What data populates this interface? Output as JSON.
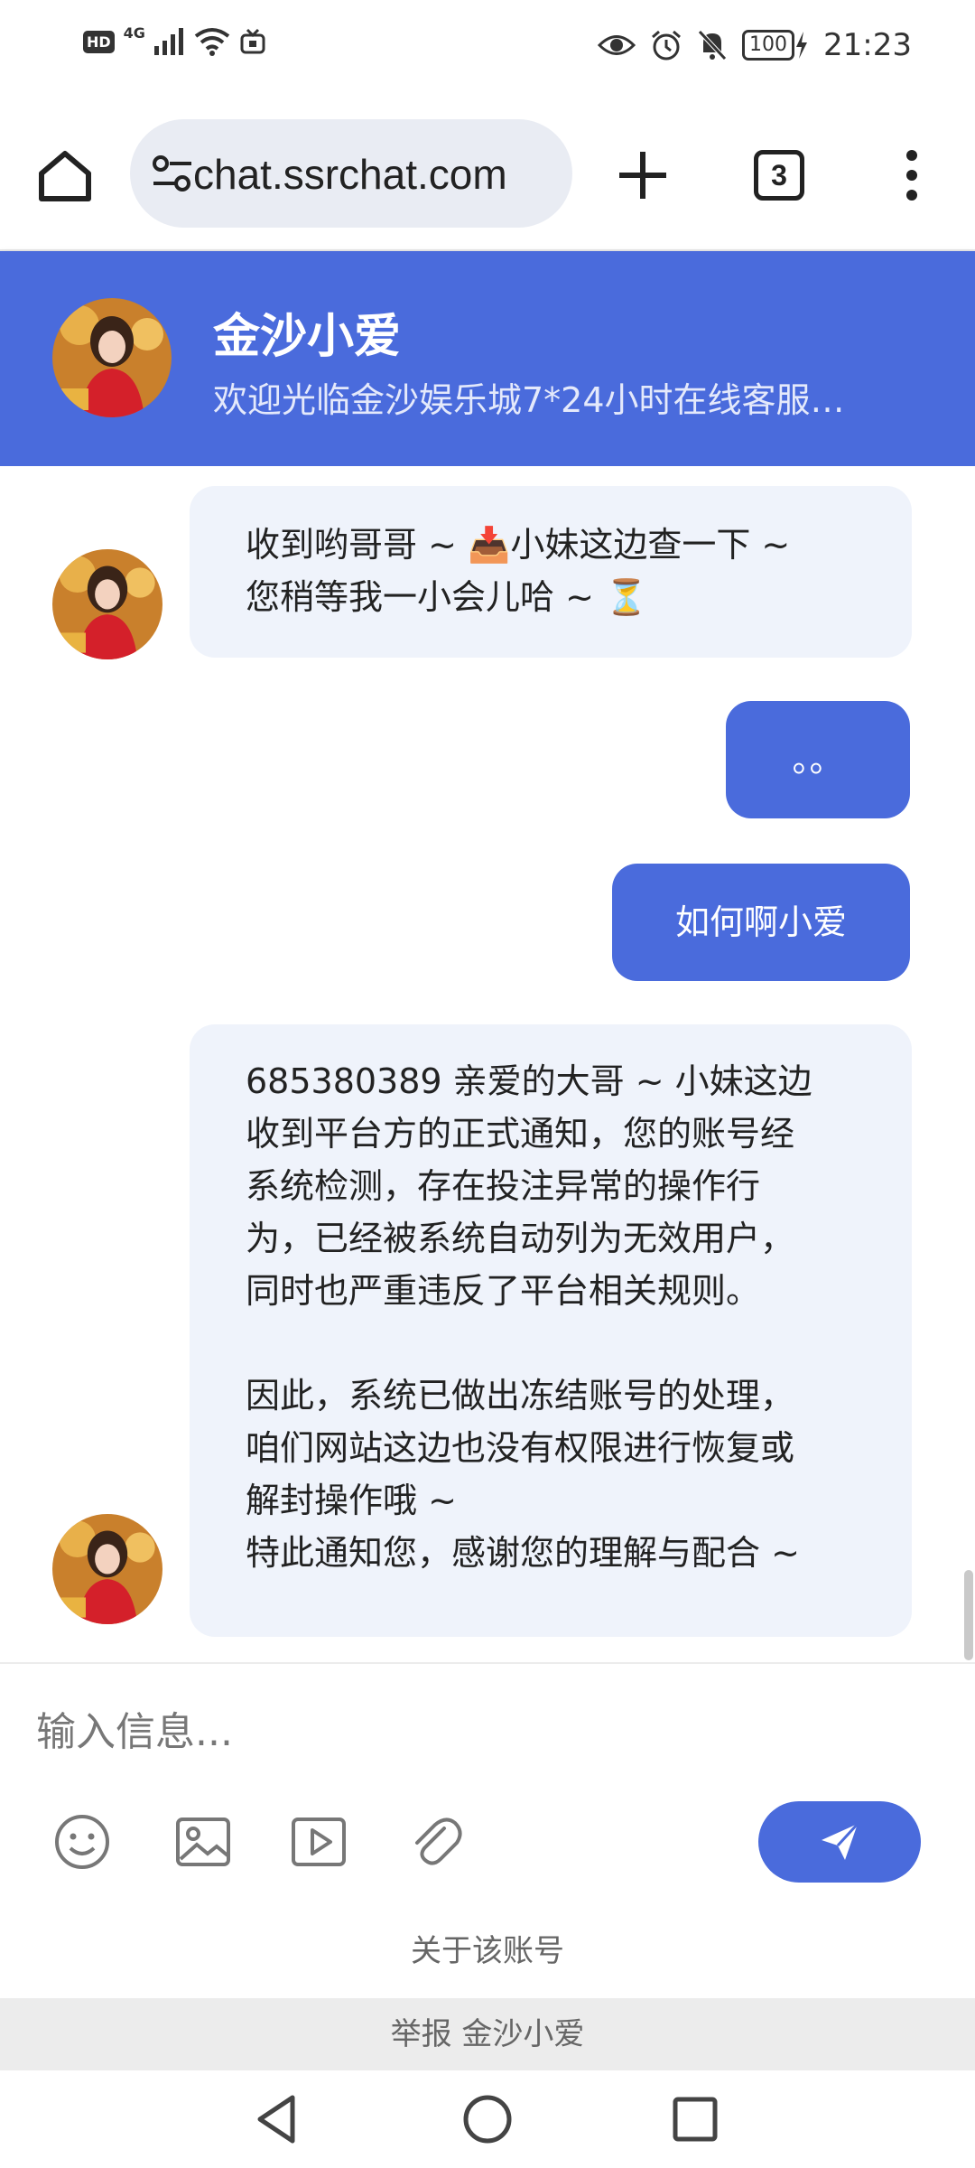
{
  "status_bar": {
    "hd": "HD",
    "network": "4G",
    "battery": "100",
    "time": "21:23"
  },
  "browser": {
    "url": "chat.ssrchat.com",
    "tab_count": "3"
  },
  "chat": {
    "title": "金沙小爱",
    "subtitle": "欢迎光临金沙娱乐城7*24小时在线客服…"
  },
  "messages": [
    {
      "from": "agent",
      "text": "收到哟哥哥 ~ 📥小妹这边查一下 ~\n您稍等我一小会儿哈 ~ ⏳"
    },
    {
      "from": "user",
      "text": "。。"
    },
    {
      "from": "user",
      "text": "如何啊小爱"
    },
    {
      "from": "agent",
      "text": "685380389 亲爱的大哥 ~ 小妹这边\n收到平台方的正式通知，您的账号经\n系统检测，存在投注异常的操作行\n为，已经被系统自动列为无效用户，\n同时也严重违反了平台相关规则。\n\n因此，系统已做出冻结账号的处理，\n咱们网站这边也没有权限进行恢复或\n解封操作哦 ~\n特此通知您，感谢您的理解与配合 ~"
    }
  ],
  "composer": {
    "placeholder": "输入信息...",
    "tools": [
      "emoji-icon",
      "image-icon",
      "video-icon",
      "attachment-icon"
    ],
    "send_icon": "send-icon"
  },
  "footer": {
    "about": "关于该账号",
    "report": "举报 金沙小爱"
  },
  "colors": {
    "accent": "#4a6bdc",
    "incoming_bubble": "#eff3fb"
  }
}
